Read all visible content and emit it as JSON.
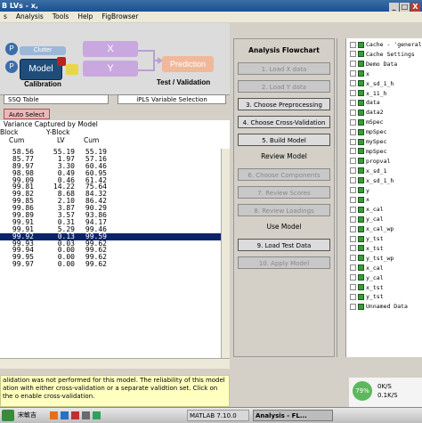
{
  "titlebar": {
    "title": "B LVs - x,",
    "buttons": [
      "_",
      "□",
      "X"
    ]
  },
  "menubar": {
    "items": [
      "s",
      "Analysis",
      "Tools",
      "Help",
      "FigBrowser"
    ]
  },
  "diagram": {
    "clutter": "Clutter",
    "model": "Model",
    "x": "X",
    "y": "Y",
    "prediction": "Prediction",
    "calibration": "Calibration",
    "test_validation": "Test / Validation",
    "p1": "P",
    "p2": "P"
  },
  "tabs": {
    "ssq": "SSQ Table",
    "iplsv": "iPLS Variable Selection"
  },
  "auto_select": "Auto Select",
  "table": {
    "caption": "Variance Captured by Model",
    "group_x": "Block",
    "group_y": "Y-Block",
    "col1": "Cum",
    "col2": "LV",
    "col3": "Cum",
    "rows": [
      [
        "58.56",
        "55.19",
        "55.19"
      ],
      [
        "85.77",
        "1.97",
        "57.16"
      ],
      [
        "89.97",
        "3.30",
        "60.46"
      ],
      [
        "98.98",
        "0.49",
        "60.95"
      ],
      [
        "99.09",
        "0.46",
        "61.42"
      ],
      [
        "99.81",
        "14.22",
        "75.64"
      ],
      [
        "99.82",
        "8.68",
        "84.32"
      ],
      [
        "99.85",
        "2.10",
        "86.42"
      ],
      [
        "99.86",
        "3.87",
        "90.29"
      ],
      [
        "99.89",
        "3.57",
        "93.86"
      ],
      [
        "99.91",
        "0.31",
        "94.17"
      ],
      [
        "99.91",
        "5.29",
        "99.46"
      ],
      [
        "99.92",
        "0.13",
        "99.59"
      ],
      [
        "99.93",
        "0.03",
        "99.62"
      ],
      [
        "99.94",
        "0.00",
        "99.62"
      ],
      [
        "99.95",
        "0.00",
        "99.62"
      ],
      [
        "99.97",
        "0.00",
        "99.62"
      ]
    ],
    "selected_row": 12
  },
  "status_message": "alidation was not performed for this model. The reliability of this model ation with either cross-validation or a separate validtion set. Click on the o enable cross-validation.",
  "flowchart": {
    "title": "Analysis Flowchart",
    "load_x": "1. Load X data",
    "load_y": "2. Load Y data",
    "preproc": "3. Choose Preprocessing",
    "crossval": "4. Choose Cross-Validation",
    "build": "5. Build Model",
    "review_hdr": "Review Model",
    "components": "6. Choose Components",
    "scores": "7. Review Scores",
    "loadings": "8. Review Loadings",
    "use_hdr": "Use Model",
    "load_test": "9. Load Test Data",
    "apply": "10. Apply Model"
  },
  "cache": {
    "items": [
      "Cache - 'general' L",
      "Cache Settings",
      "Demo Data",
      "x",
      "x_sd_1_h",
      "x_11_h",
      "data",
      "data2",
      "mSpec",
      "mpSpec",
      "mySpec",
      "mpSpec",
      "propval",
      "x_sd_1",
      "x_sd_1_h",
      "y",
      "x",
      "x_cal",
      "y_cal",
      "x_cal_wp",
      "y_tst",
      "x_tst",
      "y_tst_wp",
      "x_cal",
      "y_cal",
      "x_tst",
      "y_tst",
      "Unnamed Data"
    ]
  },
  "taskbar": {
    "items": [
      "宋敏吉",
      "MATLAB 7.10.0",
      "Analysis - FL..."
    ],
    "percent": "79%",
    "rate1": "0K/S",
    "rate2": "0.1K/S"
  }
}
